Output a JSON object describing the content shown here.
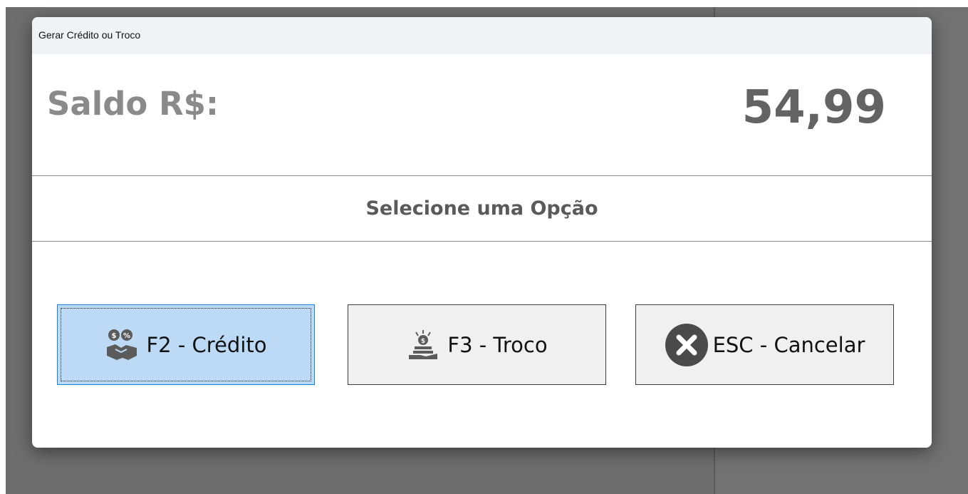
{
  "dialog": {
    "title": "Gerar Crédito ou Troco",
    "balance_label": "Saldo R$:",
    "balance_value": "54,99",
    "section_title": "Selecione uma Opção",
    "buttons": {
      "credit": {
        "label": "F2 - Crédito",
        "icon": "handshake-money-icon"
      },
      "change": {
        "label": "F3 - Troco",
        "icon": "hand-coins-icon"
      },
      "cancel": {
        "label": "ESC - Cancelar",
        "icon": "close-circle-icon"
      }
    }
  },
  "colors": {
    "credit_button_bg": "#bcdaf5",
    "credit_button_border": "#1a7fd8",
    "button_bg": "#f0f0f0",
    "label_gray": "#8a8a8a",
    "value_gray": "#636363"
  }
}
